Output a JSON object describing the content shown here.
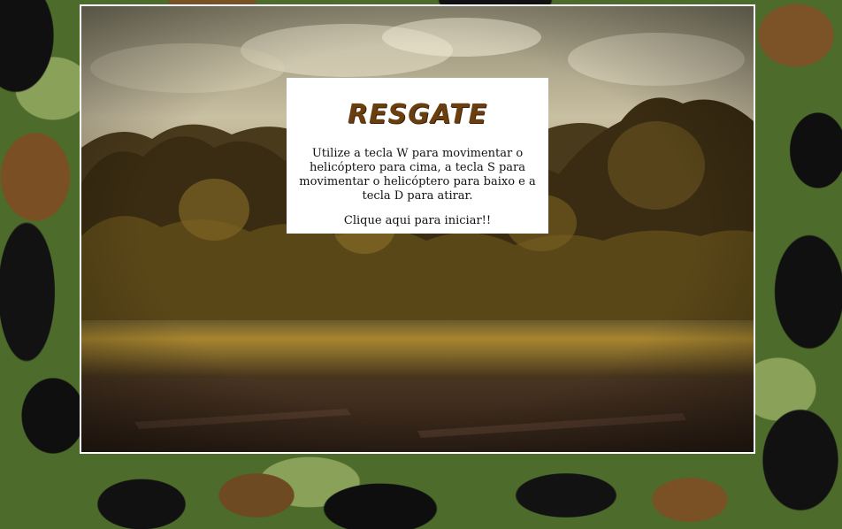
{
  "game": {
    "title": "RESGATE",
    "instructions": "Utilize a tecla W para movimentar o helicóptero para cima, a tecla S para movimentar o helicóptero para baixo e a tecla D para atirar.",
    "start_label": "Clique aqui para iniciar!!"
  },
  "colors": {
    "frame": "#ffffff",
    "title": "#6b3e10",
    "panel": "#ffffff",
    "camo_green": "#4d6b2a",
    "camo_brown": "#7a5025",
    "camo_black": "#111111"
  }
}
